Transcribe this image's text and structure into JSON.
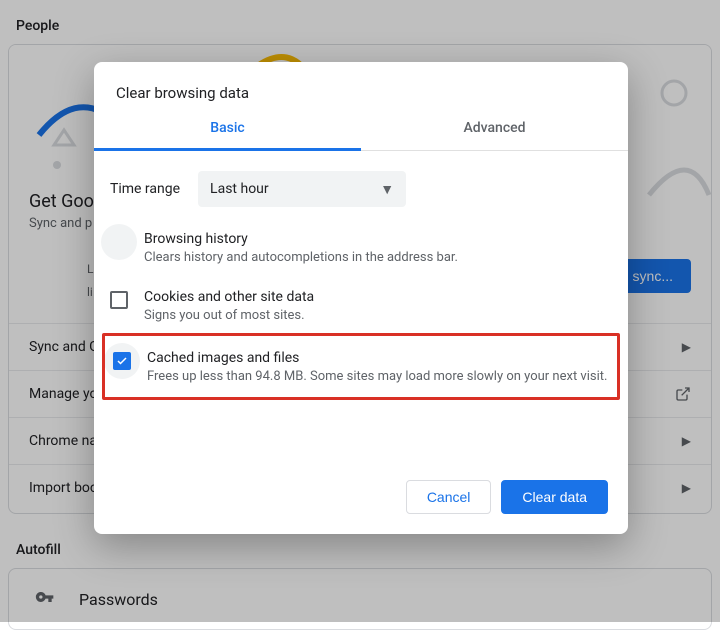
{
  "page": {
    "section_people": "People",
    "hero_title": "Get Goo",
    "hero_desc": "Sync and p",
    "hero_sub1": "L",
    "hero_sub2": "li",
    "sync_button": "n sync...",
    "rows": [
      "Sync and G",
      "Manage yo",
      "Chrome na",
      "Import boo"
    ],
    "section_autofill": "Autofill",
    "autofill_passwords": "Passwords"
  },
  "dialog": {
    "title": "Clear browsing data",
    "tabs": {
      "basic": "Basic",
      "advanced": "Advanced"
    },
    "time_label": "Time range",
    "time_value": "Last hour",
    "options": [
      {
        "title": "Browsing history",
        "desc": "Clears history and autocompletions in the address bar.",
        "checked": false
      },
      {
        "title": "Cookies and other site data",
        "desc": "Signs you out of most sites.",
        "checked": false
      },
      {
        "title": "Cached images and files",
        "desc": "Frees up less than 94.8 MB. Some sites may load more slowly on your next visit.",
        "checked": true
      }
    ],
    "cancel": "Cancel",
    "clear": "Clear data"
  }
}
